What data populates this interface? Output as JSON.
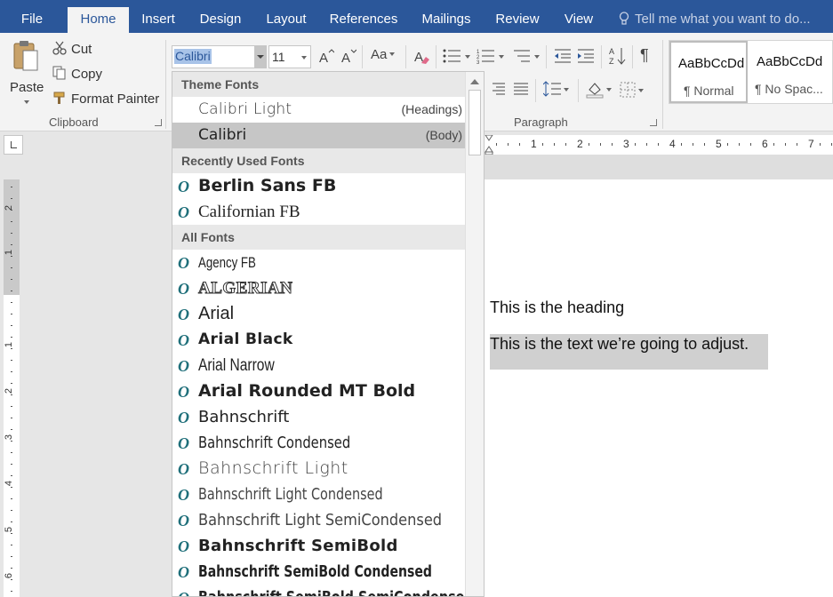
{
  "tabs": [
    {
      "label": "File"
    },
    {
      "label": "Home"
    },
    {
      "label": "Insert"
    },
    {
      "label": "Design"
    },
    {
      "label": "Layout"
    },
    {
      "label": "References"
    },
    {
      "label": "Mailings"
    },
    {
      "label": "Review"
    },
    {
      "label": "View"
    }
  ],
  "tell_me": {
    "placeholder": "Tell me what you want to do..."
  },
  "clipboard": {
    "paste_label": "Paste",
    "cut_label": "Cut",
    "copy_label": "Copy",
    "format_painter_label": "Format Painter",
    "group_label": "Clipboard"
  },
  "font": {
    "name_value": "Calibri",
    "size_value": "11",
    "change_case_label": "Aa"
  },
  "paragraph": {
    "group_label": "Paragraph"
  },
  "styles": [
    {
      "sample": "AaBbCcDd",
      "name": "¶ Normal"
    },
    {
      "sample": "AaBbCcDd",
      "name": "¶ No Spac..."
    }
  ],
  "ruler": {
    "labels": [
      "1",
      "2",
      "3",
      "4",
      "5",
      "6",
      "7"
    ]
  },
  "vruler": {
    "labels": [
      "2",
      "1",
      "1",
      "2",
      "3",
      "4",
      "5",
      "6"
    ]
  },
  "document": {
    "heading": "This is the heading",
    "body": "This is the text we’re going to adjust."
  },
  "font_list": {
    "theme_header": "Theme Fonts",
    "theme_fonts": [
      {
        "name": "Calibri Light",
        "hint": "(Headings)"
      },
      {
        "name": "Calibri",
        "hint": "(Body)"
      }
    ],
    "recent_header": "Recently Used Fonts",
    "recent_fonts": [
      {
        "name": "Berlin Sans FB"
      },
      {
        "name": "Californian FB"
      }
    ],
    "all_header": "All Fonts",
    "all_fonts": [
      {
        "name": "Agency FB"
      },
      {
        "name": "ALGERIAN"
      },
      {
        "name": "Arial"
      },
      {
        "name": "Arial Black"
      },
      {
        "name": "Arial Narrow"
      },
      {
        "name": "Arial Rounded MT Bold"
      },
      {
        "name": "Bahnschrift"
      },
      {
        "name": "Bahnschrift Condensed"
      },
      {
        "name": "Bahnschrift Light"
      },
      {
        "name": "Bahnschrift Light Condensed"
      },
      {
        "name": "Bahnschrift Light SemiCondensed"
      },
      {
        "name": "Bahnschrift SemiBold"
      },
      {
        "name": "Bahnschrift SemiBold Condensed"
      },
      {
        "name": "Bahnschrift SemiBold SemiCondensed"
      }
    ]
  },
  "colors": {
    "ribbon_blue": "#2b579a",
    "selection": "#c6c6c6",
    "opentype_teal": "#1f6f7a"
  }
}
